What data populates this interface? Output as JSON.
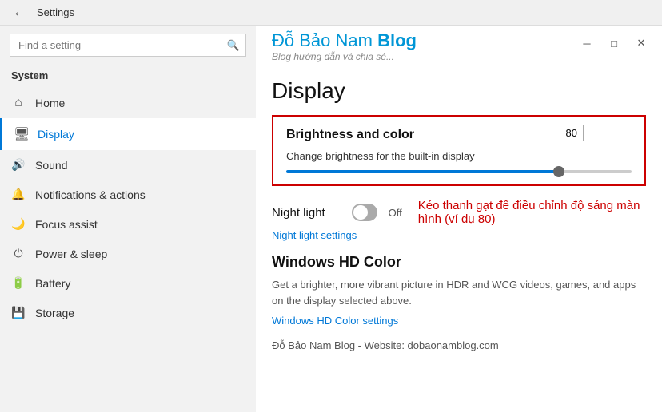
{
  "titlebar": {
    "title": "Settings",
    "back_icon": "←",
    "min_icon": "─",
    "max_icon": "□",
    "close_icon": "✕"
  },
  "blog": {
    "title_plain": "Đỗ Bảo Nam ",
    "title_bold": "Blog",
    "subtitle": "Blog hướng dẫn và chia sẻ..."
  },
  "sidebar": {
    "search_placeholder": "Find a setting",
    "search_icon": "🔍",
    "section_title": "System",
    "items": [
      {
        "id": "home",
        "label": "Home",
        "icon": "⌂"
      },
      {
        "id": "display",
        "label": "Display",
        "icon": "🖥",
        "active": true
      },
      {
        "id": "sound",
        "label": "Sound",
        "icon": "🔊"
      },
      {
        "id": "notifications",
        "label": "Notifications & actions",
        "icon": "🔔"
      },
      {
        "id": "focus",
        "label": "Focus assist",
        "icon": "🌙"
      },
      {
        "id": "power",
        "label": "Power & sleep",
        "icon": "⏻"
      },
      {
        "id": "battery",
        "label": "Battery",
        "icon": "🔋"
      },
      {
        "id": "storage",
        "label": "Storage",
        "icon": "💾"
      }
    ]
  },
  "page": {
    "title": "Display",
    "brightness_section": {
      "title": "Brightness and color",
      "value": "80",
      "description": "Change brightness for the built-in display",
      "slider_percent": 80
    },
    "night_light": {
      "label": "Night light",
      "toggle_state": "Off",
      "annotation": "Kéo thanh gạt để điều chỉnh độ sáng màn hình (ví dụ 80)"
    },
    "night_light_settings_link": "Night light settings",
    "hd_color_section": {
      "title": "Windows HD Color",
      "description": "Get a brighter, more vibrant picture in HDR and WCG videos, games, and apps on the display selected above.",
      "link": "Windows HD Color settings"
    },
    "watermark": "Đỗ Bảo Nam Blog - Website: dobaonamblog.com"
  }
}
